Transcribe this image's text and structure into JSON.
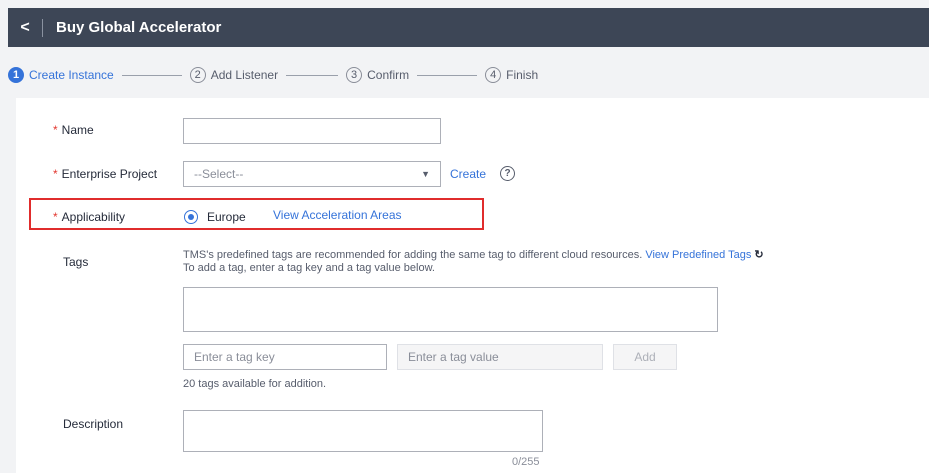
{
  "header": {
    "back_icon": "chevron-left-icon",
    "title": "Buy Global Accelerator"
  },
  "steps": [
    {
      "num": "1",
      "label": "Create Instance",
      "active": true
    },
    {
      "num": "2",
      "label": "Add Listener",
      "active": false
    },
    {
      "num": "3",
      "label": "Confirm",
      "active": false
    },
    {
      "num": "4",
      "label": "Finish",
      "active": false
    }
  ],
  "form": {
    "name": {
      "label": "Name",
      "required_mark": "*",
      "value": ""
    },
    "enterprise_project": {
      "label": "Enterprise Project",
      "required_mark": "*",
      "placeholder": "--Select--",
      "create_link": "Create",
      "help_icon": "?"
    },
    "applicability": {
      "label": "Applicability",
      "required_mark": "*",
      "option": "Europe",
      "selected": true,
      "link": "View Acceleration Areas"
    },
    "tags": {
      "label": "Tags",
      "hint_line1": "TMS's predefined tags are recommended for adding the same tag to different cloud resources.",
      "hint_link": "View Predefined Tags",
      "refresh_icon": "refresh-icon",
      "hint_line2": "To add a tag, enter a tag key and a tag value below.",
      "key_placeholder": "Enter a tag key",
      "value_placeholder": "Enter a tag value",
      "add_button": "Add",
      "available_text": "20 tags available for addition."
    },
    "description": {
      "label": "Description",
      "counter": "0/255"
    }
  },
  "colors": {
    "accent": "#3573d9",
    "header_bg": "#3d4656",
    "required": "#e2372f",
    "highlight_border": "#e02c2c"
  }
}
